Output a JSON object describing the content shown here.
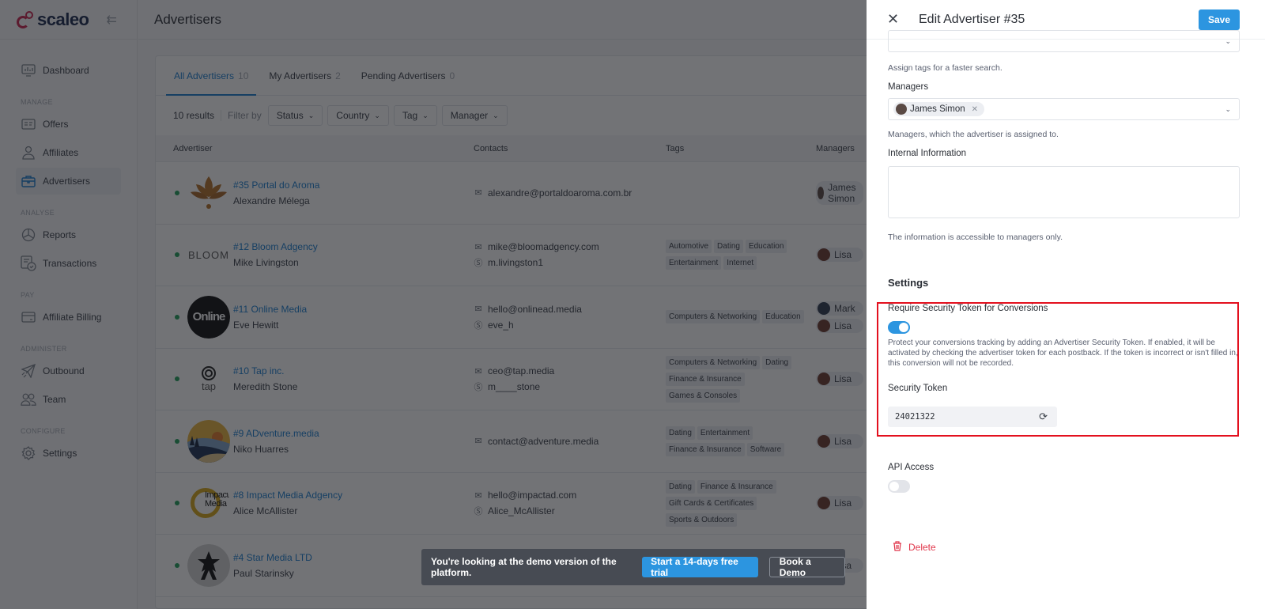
{
  "app": {
    "brand": "scaleo",
    "page_title": "Advertisers"
  },
  "sidebar": {
    "items": [
      {
        "label": "Dashboard",
        "icon": "dashboard-icon",
        "section": null
      },
      {
        "label": "Offers",
        "icon": "offers-icon",
        "section": "MANAGE"
      },
      {
        "label": "Affiliates",
        "icon": "affiliates-icon",
        "section": null
      },
      {
        "label": "Advertisers",
        "icon": "briefcase-icon",
        "section": null,
        "active": true
      },
      {
        "label": "Reports",
        "icon": "pie-chart-icon",
        "section": "ANALYSE"
      },
      {
        "label": "Transactions",
        "icon": "transactions-icon",
        "section": null
      },
      {
        "label": "Affiliate Billing",
        "icon": "credit-card-icon",
        "section": "PAY"
      },
      {
        "label": "Outbound",
        "icon": "paper-plane-icon",
        "section": "ADMINISTER"
      },
      {
        "label": "Team",
        "icon": "team-icon",
        "section": null
      },
      {
        "label": "Settings",
        "icon": "gear-icon",
        "section": "CONFIGURE"
      }
    ],
    "sections": {
      "manage": "MANAGE",
      "analyse": "ANALYSE",
      "pay": "PAY",
      "administer": "ADMINISTER",
      "configure": "CONFIGURE"
    }
  },
  "tabs": [
    {
      "label": "All Advertisers",
      "count": "10",
      "active": true
    },
    {
      "label": "My Advertisers",
      "count": "2"
    },
    {
      "label": "Pending Advertisers",
      "count": "0"
    }
  ],
  "filters": {
    "results": "10 results",
    "filter_by": "Filter by",
    "buttons": [
      "Status",
      "Country",
      "Tag",
      "Manager"
    ]
  },
  "table": {
    "headers": {
      "advertiser": "Advertiser",
      "contacts": "Contacts",
      "tags": "Tags",
      "managers": "Managers"
    },
    "rows": [
      {
        "name": "#35 Portal do Aroma",
        "person": "Alexandre Mélega",
        "email": "alexandre@portaldoaroma.com.br",
        "skype": "",
        "tags": [],
        "managers": [
          "James Simon"
        ],
        "logo": "lotus"
      },
      {
        "name": "#12 Bloom Adgency",
        "person": "Mike Livingston",
        "email": "mike@bloomadgency.com",
        "skype": "m.livingston1",
        "tags": [
          "Automotive",
          "Dating",
          "Education",
          "Entertainment",
          "Internet"
        ],
        "managers": [
          "Lisa"
        ],
        "logo": "BLOOM"
      },
      {
        "name": "#11 Online Media",
        "person": "Eve Hewitt",
        "email": "hello@onlinead.media",
        "skype": "eve_h",
        "tags": [
          "Computers & Networking",
          "Education"
        ],
        "managers": [
          "Mark",
          "Lisa"
        ],
        "logo": "Online"
      },
      {
        "name": "#10 Tap inc.",
        "person": "Meredith Stone",
        "email": "ceo@tap.media",
        "skype": "m____stone",
        "tags": [
          "Computers & Networking",
          "Dating",
          "Finance & Insurance",
          "Games & Consoles"
        ],
        "managers": [
          "Lisa"
        ],
        "logo": "tap"
      },
      {
        "name": "#9 ADventure.media",
        "person": "Niko Huarres",
        "email": "contact@adventure.media",
        "skype": "",
        "tags": [
          "Dating",
          "Entertainment",
          "Finance & Insurance",
          "Software"
        ],
        "managers": [
          "Lisa"
        ],
        "logo": "landscape"
      },
      {
        "name": "#8 Impact Media Adgency",
        "person": "Alice McAllister",
        "email": "hello@impactad.com",
        "skype": "Alice_McAllister",
        "tags": [
          "Dating",
          "Finance & Insurance",
          "Gift Cards & Certificates",
          "Sports & Outdoors"
        ],
        "managers": [
          "Lisa"
        ],
        "logo": "Impact Media"
      },
      {
        "name": "#4 Star Media LTD",
        "person": "Paul Starinsky",
        "email": "",
        "skype": "",
        "tags": [],
        "managers": [
          "Lisa"
        ],
        "logo": "star"
      }
    ]
  },
  "banner": {
    "text": "You're looking at the demo version of the platform.",
    "trial_label": "Start a 14-days free trial",
    "demo_label": "Book a Demo"
  },
  "drawer": {
    "title": "Edit Advertiser #35",
    "save_label": "Save",
    "tags_hint": "Assign tags for a faster search.",
    "managers_label": "Managers",
    "managers_selected": "James Simon",
    "managers_hint": "Managers, which the advertiser is assigned to.",
    "internal_label": "Internal Information",
    "internal_value": "",
    "internal_hint": "The information is accessible to managers only.",
    "settings_heading": "Settings",
    "security_toggle_label": "Require Security Token for Conversions",
    "security_toggle_on": true,
    "security_desc": "Protect your conversions tracking by adding an Advertiser Security Token. If enabled, it will be activated by checking the advertiser token for each postback. If the token is incorrect or isn't filled in, this conversion will not be recorded.",
    "token_label": "Security Token",
    "token_value": "24021322",
    "api_label": "API Access",
    "api_toggle_on": false,
    "delete_label": "Delete",
    "accent": "#2c95e0",
    "danger": "#e0354a",
    "highlight": "#e3101e"
  }
}
